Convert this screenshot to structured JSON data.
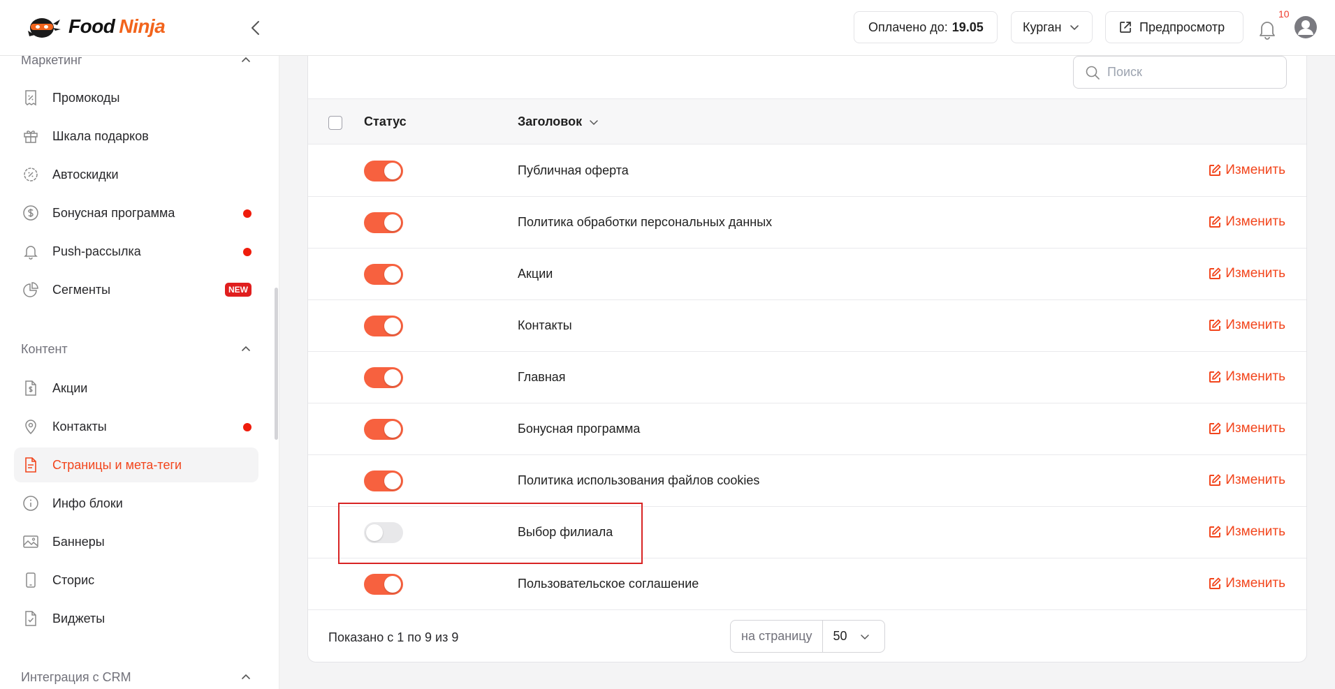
{
  "brand": {
    "word1": "Food",
    "word2": "Ninja"
  },
  "header": {
    "paid_label": "Оплачено до:",
    "paid_value": "19.05",
    "city": "Курган",
    "preview": "Предпросмотр",
    "notifications": "10"
  },
  "sidebar": {
    "sections": [
      {
        "label": "Маркетинг"
      },
      {
        "label": "Контент"
      },
      {
        "label": "Интеграция с CRM"
      }
    ],
    "marketing": [
      {
        "label": "Промокоды",
        "icon": "receipt-percent-icon"
      },
      {
        "label": "Шкала подарков",
        "icon": "gift-icon"
      },
      {
        "label": "Автоскидки",
        "icon": "discount-badge-icon"
      },
      {
        "label": "Бонусная программа",
        "icon": "dollar-circle-icon",
        "dot": true
      },
      {
        "label": "Push-рассылка",
        "icon": "bell-icon",
        "dot": true
      },
      {
        "label": "Сегменты",
        "icon": "pie-chart-icon",
        "badge": "NEW"
      }
    ],
    "content": [
      {
        "label": "Акции",
        "icon": "document-dollar-icon"
      },
      {
        "label": "Контакты",
        "icon": "map-pin-icon",
        "dot": true
      },
      {
        "label": "Страницы и мета-теги",
        "icon": "document-text-icon",
        "active": true
      },
      {
        "label": "Инфо блоки",
        "icon": "info-circle-icon"
      },
      {
        "label": "Баннеры",
        "icon": "image-icon"
      },
      {
        "label": "Сторис",
        "icon": "phone-icon"
      },
      {
        "label": "Виджеты",
        "icon": "document-check-icon"
      }
    ]
  },
  "search": {
    "placeholder": "Поиск"
  },
  "table": {
    "headers": {
      "status": "Статус",
      "title": "Заголовок"
    },
    "edit_label": "Изменить",
    "rows": [
      {
        "title": "Публичная оферта",
        "enabled": true
      },
      {
        "title": "Политика обработки персональных данных",
        "enabled": true
      },
      {
        "title": "Акции",
        "enabled": true
      },
      {
        "title": "Контакты",
        "enabled": true
      },
      {
        "title": "Главная",
        "enabled": true
      },
      {
        "title": "Бонусная программа",
        "enabled": true
      },
      {
        "title": "Политика использования файлов cookies",
        "enabled": true
      },
      {
        "title": "Выбор филиала",
        "enabled": false
      },
      {
        "title": "Пользовательское соглашение",
        "enabled": true
      }
    ]
  },
  "footer": {
    "shown": "Показано с 1 по 9 из 9",
    "per_page_label": "на страницу",
    "per_page_value": "50"
  },
  "colors": {
    "accent": "#f2451c",
    "toggle_on": "#f7613f",
    "dot": "#ef1c0c"
  }
}
